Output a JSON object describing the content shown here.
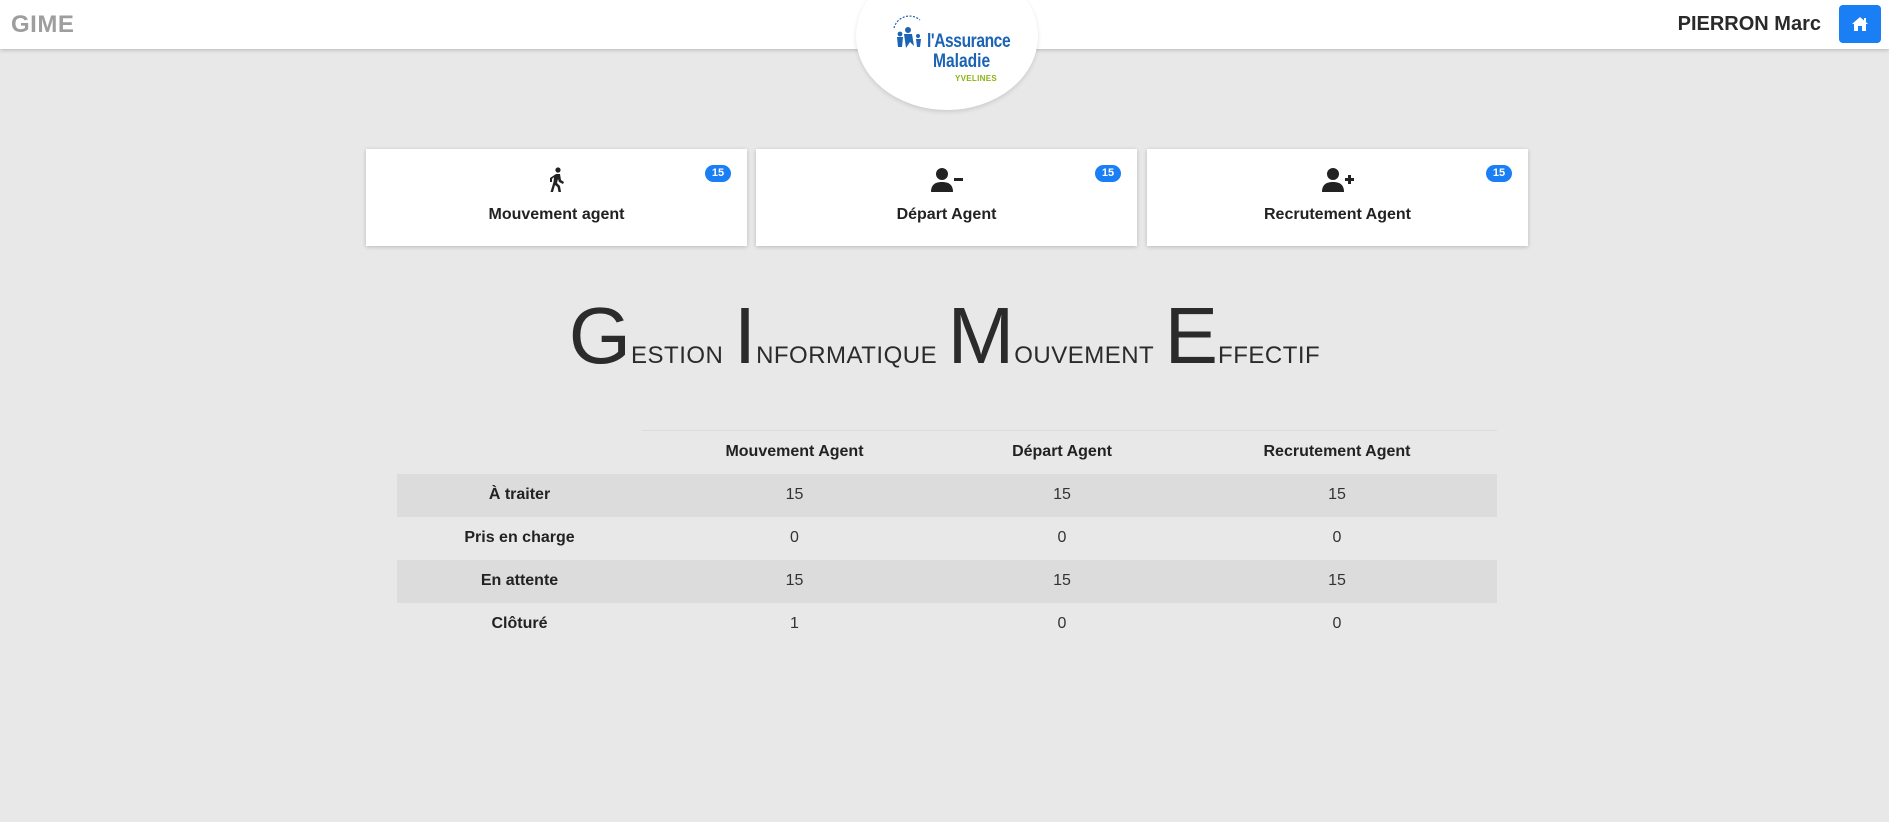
{
  "header": {
    "app_name": "GIME",
    "user_name": "PIERRON Marc",
    "home_icon": "home-icon"
  },
  "logo": {
    "line1": "l'Assurance",
    "line2": "Maladie",
    "line3": "YVELINES",
    "colors": {
      "blue": "#1a63b5",
      "green": "#8bb313"
    }
  },
  "cards": [
    {
      "label": "Mouvement agent",
      "badge": "15",
      "icon": "walking-person-icon"
    },
    {
      "label": "Départ Agent",
      "badge": "15",
      "icon": "user-minus-icon"
    },
    {
      "label": "Recrutement Agent",
      "badge": "15",
      "icon": "user-plus-icon"
    }
  ],
  "title": {
    "words": [
      {
        "cap": "G",
        "rest": "ESTION"
      },
      {
        "cap": "I",
        "rest": "NFORMATIQUE"
      },
      {
        "cap": "M",
        "rest": "OUVEMENT"
      },
      {
        "cap": "E",
        "rest": "FFECTIF"
      }
    ]
  },
  "table": {
    "columns": [
      "Mouvement Agent",
      "Départ Agent",
      "Recrutement Agent"
    ],
    "rows": [
      {
        "label": "À traiter",
        "values": [
          "15",
          "15",
          "15"
        ]
      },
      {
        "label": "Pris en charge",
        "values": [
          "0",
          "0",
          "0"
        ]
      },
      {
        "label": "En attente",
        "values": [
          "15",
          "15",
          "15"
        ]
      },
      {
        "label": "Clôturé",
        "values": [
          "1",
          "0",
          "0"
        ]
      }
    ]
  },
  "colors": {
    "accent": "#1a7ef5",
    "background": "#e8e8e8",
    "stripe": "#dcdcdc"
  }
}
